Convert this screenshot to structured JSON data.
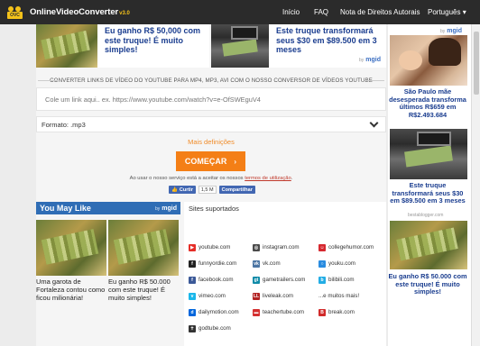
{
  "header": {
    "logo_badge": "OVC",
    "logo_text": "OnlineVideoConverter",
    "logo_version": "v3.0",
    "nav": [
      "Início",
      "FAQ",
      "Nota de Direitos Autorais",
      "Português ▾"
    ]
  },
  "top_ads": [
    {
      "title": "Eu ganho R$ 50,000 com este truque! É muito simples!"
    },
    {
      "title": "Este truque transformará seus $30 em $89.500 em 3 meses"
    }
  ],
  "ads_brand": {
    "by": "by",
    "name": "mgid"
  },
  "converter": {
    "section_label": "CONVERTER LINKS DE VÍDEO DO YOUTUBE PARA MP4, MP3, AVI COM O NOSSO CONVERSOR DE VÍDEOS YOUTUBE",
    "input_placeholder": "Cole um link aqui.. ex. https://www.youtube.com/watch?v=e-OfSWEguV4",
    "format_label": "Formato: .mp3",
    "more_settings": "Mais definições",
    "start_label": "COMEÇAR",
    "start_arrow": "›",
    "terms_prefix": "Ao usar o nosso serviço está a aceitar os nossos ",
    "terms_link": "termos de utilização",
    "terms_suffix": ".",
    "fb_like": "Curtir",
    "fb_count": "1,5 M",
    "fb_share": "Compartilhar"
  },
  "you_may_like": {
    "title": "You May Like",
    "items": [
      {
        "caption": "Uma garota de Fortaleza contou como ficou milionária!"
      },
      {
        "caption": "Eu ganho R$ 50.000 com este truque! É muito simples!"
      }
    ]
  },
  "sites": {
    "title": "Sites suportados",
    "list": [
      {
        "name": "youtube.com",
        "icon": "youtube-icon",
        "color": "#e52d27",
        "glyph": "▶"
      },
      {
        "name": "instagram.com",
        "icon": "instagram-icon",
        "color": "#4b4b4b",
        "glyph": "◎"
      },
      {
        "name": "collegehumor.com",
        "icon": "collegehumor-icon",
        "color": "#d6282f",
        "glyph": "☺"
      },
      {
        "name": "funnyordie.com",
        "icon": "funnyordie-icon",
        "color": "#222222",
        "glyph": "f"
      },
      {
        "name": "vk.com",
        "icon": "vk-icon",
        "color": "#4c75a3",
        "glyph": "vk"
      },
      {
        "name": "youku.com",
        "icon": "youku-icon",
        "color": "#2a8ce0",
        "glyph": "○"
      },
      {
        "name": "facebook.com",
        "icon": "facebook-icon",
        "color": "#3b5998",
        "glyph": "f"
      },
      {
        "name": "gametrailers.com",
        "icon": "gametrailers-icon",
        "color": "#0f8ba8",
        "glyph": "gt"
      },
      {
        "name": "bilibili.com",
        "icon": "bilibili-icon",
        "color": "#23ade5",
        "glyph": "b"
      },
      {
        "name": "vimeo.com",
        "icon": "vimeo-icon",
        "color": "#1ab7ea",
        "glyph": "v"
      },
      {
        "name": "liveleak.com",
        "icon": "liveleak-icon",
        "color": "#b22222",
        "glyph": "LL"
      },
      {
        "name": "...e muitos mais!",
        "icon": "none",
        "color": "#ffffff",
        "glyph": ""
      },
      {
        "name": "dailymotion.com",
        "icon": "dailymotion-icon",
        "color": "#0066dc",
        "glyph": "d"
      },
      {
        "name": "teachertube.com",
        "icon": "teachertube-icon",
        "color": "#d43030",
        "glyph": "▬"
      },
      {
        "name": "break.com",
        "icon": "break-icon",
        "color": "#d12b2b",
        "glyph": "B"
      },
      {
        "name": "godtube.com",
        "icon": "godtube-icon",
        "color": "#333333",
        "glyph": "✝"
      }
    ]
  },
  "sidebar": {
    "ads": [
      {
        "title": "São Paulo mãe desesperada transforma últimos R$659 em R$2.493.684"
      },
      {
        "title": "Este truque transformará seus $30 em $89.500 em 3 meses"
      },
      {
        "title": "Eu ganho R$ 50.000 com este truque! É muito simples!"
      }
    ],
    "note": "bestablogger.com"
  }
}
